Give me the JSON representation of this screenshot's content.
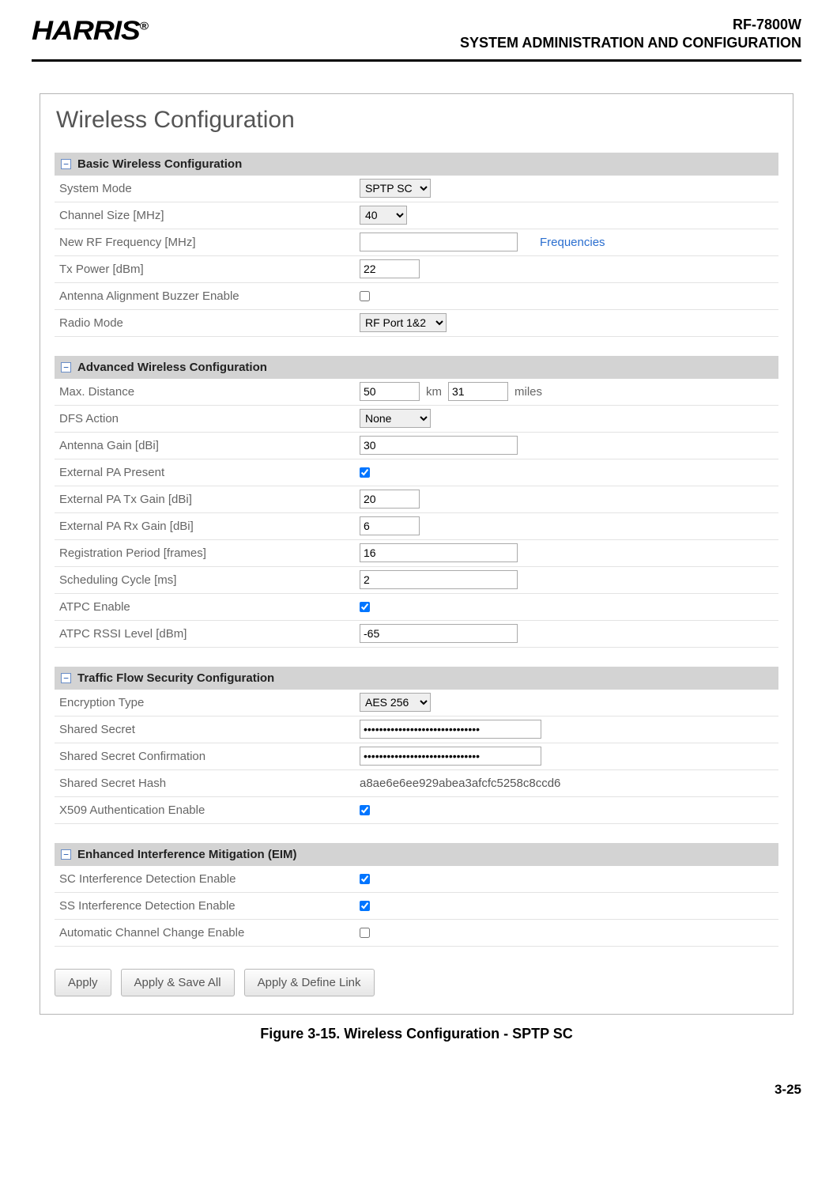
{
  "header": {
    "logo_text": "HARRIS",
    "logo_reg": "®",
    "doc_id": "RF-7800W",
    "doc_title": "SYSTEM ADMINISTRATION AND CONFIGURATION"
  },
  "page": {
    "title": "Wireless Configuration"
  },
  "sections": {
    "basic": {
      "title": "Basic Wireless Configuration",
      "system_mode_label": "System Mode",
      "system_mode_value": "SPTP SC",
      "channel_size_label": "Channel Size [MHz]",
      "channel_size_value": "40",
      "new_rf_freq_label": "New RF Frequency [MHz]",
      "new_rf_freq_value": "",
      "frequencies_link": "Frequencies",
      "tx_power_label": "Tx Power [dBm]",
      "tx_power_value": "22",
      "buzzer_label": "Antenna Alignment Buzzer Enable",
      "radio_mode_label": "Radio Mode",
      "radio_mode_value": "RF Port 1&2"
    },
    "advanced": {
      "title": "Advanced Wireless Configuration",
      "max_distance_label": "Max. Distance",
      "max_distance_km": "50",
      "max_distance_km_unit": "km",
      "max_distance_mi": "31",
      "max_distance_mi_unit": "miles",
      "dfs_action_label": "DFS Action",
      "dfs_action_value": "None",
      "antenna_gain_label": "Antenna Gain [dBi]",
      "antenna_gain_value": "30",
      "ext_pa_present_label": "External PA Present",
      "ext_pa_tx_label": "External PA Tx Gain [dBi]",
      "ext_pa_tx_value": "20",
      "ext_pa_rx_label": "External PA Rx Gain [dBi]",
      "ext_pa_rx_value": "6",
      "reg_period_label": "Registration Period [frames]",
      "reg_period_value": "16",
      "sched_cycle_label": "Scheduling Cycle [ms]",
      "sched_cycle_value": "2",
      "atpc_enable_label": "ATPC Enable",
      "atpc_rssi_label": "ATPC RSSI Level [dBm]",
      "atpc_rssi_value": "-65"
    },
    "traffic": {
      "title": "Traffic Flow Security Configuration",
      "encryption_label": "Encryption Type",
      "encryption_value": "AES 256",
      "shared_secret_label": "Shared Secret",
      "shared_secret_value": "••••••••••••••••••••••••••••••",
      "shared_secret_conf_label": "Shared Secret Confirmation",
      "shared_secret_conf_value": "••••••••••••••••••••••••••••••",
      "hash_label": "Shared Secret Hash",
      "hash_value": "a8ae6e6ee929abea3afcfc5258c8ccd6",
      "x509_label": "X509 Authentication Enable"
    },
    "eim": {
      "title": "Enhanced Interference Mitigation (EIM)",
      "sc_detect_label": "SC Interference Detection Enable",
      "ss_detect_label": "SS Interference Detection Enable",
      "auto_channel_label": "Automatic Channel Change Enable"
    }
  },
  "buttons": {
    "apply": "Apply",
    "apply_save": "Apply & Save All",
    "apply_define": "Apply & Define Link"
  },
  "figure_caption": "Figure 3-15.  Wireless Configuration - SPTP SC",
  "page_number": "3-25"
}
